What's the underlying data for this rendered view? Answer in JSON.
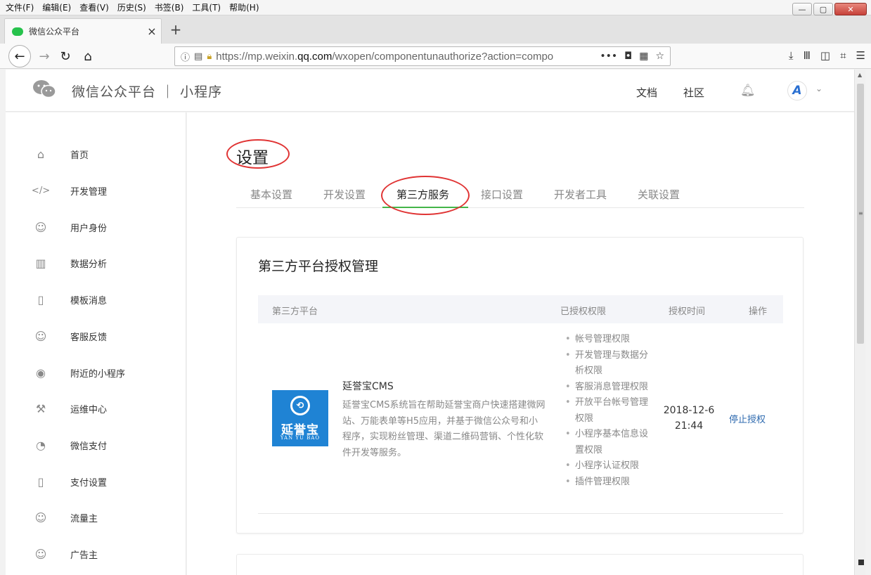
{
  "browser": {
    "menu": [
      "文件(F)",
      "编辑(E)",
      "查看(V)",
      "历史(S)",
      "书签(B)",
      "工具(T)",
      "帮助(H)"
    ],
    "tab_title": "微信公众平台",
    "url_host_prefix": "https://mp.weixin.",
    "url_host_main": "qq.com",
    "url_path": "/wxopen/componentunauthorize?action=compo"
  },
  "header": {
    "brand": "微信公众平台 ｜ 小程序",
    "docs": "文档",
    "community": "社区"
  },
  "sidebar": {
    "items": [
      {
        "label": "首页",
        "icon": "home-icon"
      },
      {
        "label": "开发管理",
        "icon": "code-icon"
      },
      {
        "label": "用户身份",
        "icon": "user-icon"
      },
      {
        "label": "数据分析",
        "icon": "chart-icon"
      },
      {
        "label": "模板消息",
        "icon": "document-icon"
      },
      {
        "label": "客服反馈",
        "icon": "support-icon"
      },
      {
        "label": "附近的小程序",
        "icon": "location-icon"
      },
      {
        "label": "运维中心",
        "icon": "wrench-icon"
      },
      {
        "label": "微信支付",
        "icon": "wechat-pay-icon"
      },
      {
        "label": "支付设置",
        "icon": "phone-settings-icon"
      },
      {
        "label": "流量主",
        "icon": "user-yen-icon"
      },
      {
        "label": "广告主",
        "icon": "user-ad-icon"
      }
    ]
  },
  "main": {
    "title": "设置",
    "tabs": [
      "基本设置",
      "开发设置",
      "第三方服务",
      "接口设置",
      "开发者工具",
      "关联设置"
    ],
    "active_tab": "第三方服务",
    "section_title": "第三方平台授权管理",
    "table": {
      "headers": [
        "第三方平台",
        "已授权权限",
        "授权时间",
        "操作"
      ],
      "row": {
        "logo_cn": "延誉宝",
        "logo_en": "YAN YU BAO",
        "name": "延誉宝CMS",
        "description": "延誉宝CMS系统旨在帮助延誉宝商户快速搭建微网站、万能表单等H5应用，并基于微信公众号和小程序，实现粉丝管理、渠道二维码营销、个性化软件开发等服务。",
        "permissions": [
          "帐号管理权限",
          "开发管理与数据分析权限",
          "客服消息管理权限",
          "开放平台帐号管理权限",
          "小程序基本信息设置权限",
          "小程序认证权限",
          "插件管理权限"
        ],
        "auth_date": "2018-12-6",
        "auth_time": "21:44",
        "action": "停止授权"
      }
    }
  },
  "colors": {
    "accent_green": "#44b549",
    "link_blue": "#2e6aaf",
    "annotation_red": "#e03434",
    "logo_blue": "#1f83d4"
  }
}
